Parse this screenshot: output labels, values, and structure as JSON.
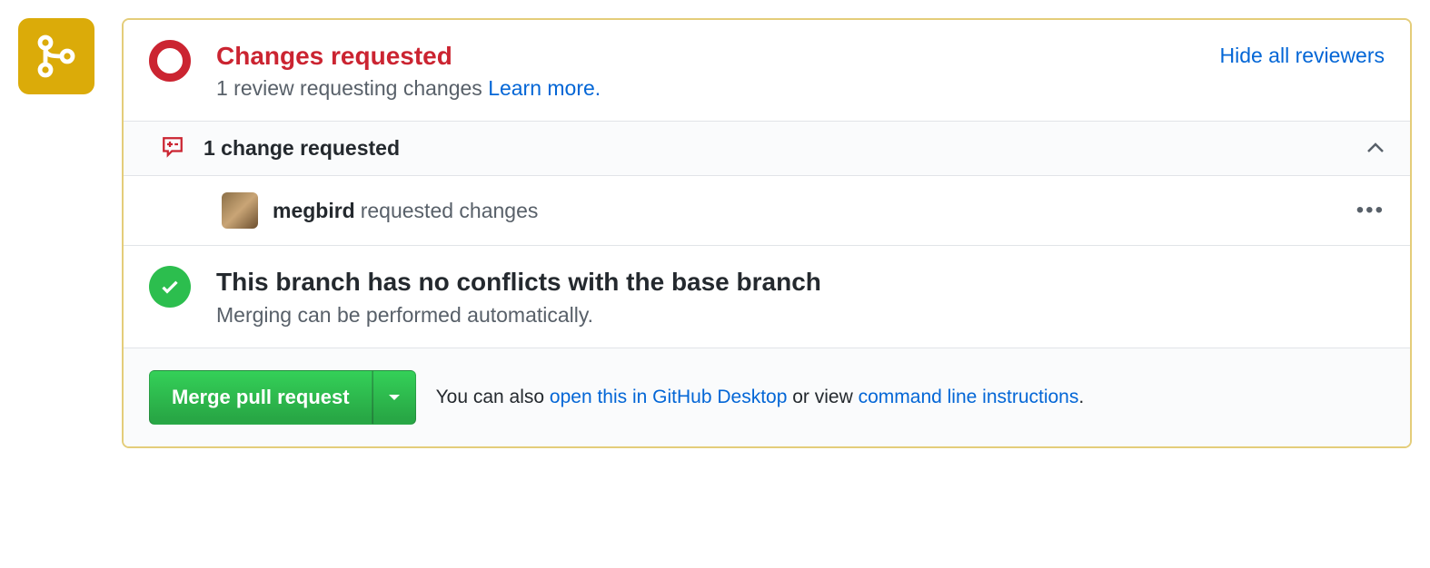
{
  "header": {
    "title": "Changes requested",
    "subtext_prefix": "1 review requesting changes ",
    "learn_more": "Learn more.",
    "hide_link": "Hide all reviewers"
  },
  "changebar": {
    "title": "1 change requested"
  },
  "reviewer": {
    "username": "megbird",
    "action": " requested changes"
  },
  "conflicts": {
    "title": "This branch has no conflicts with the base branch",
    "subtext": "Merging can be performed automatically."
  },
  "merge": {
    "button": "Merge pull request",
    "also_prefix": "You can also ",
    "desktop_link": "open this in GitHub Desktop",
    "or_view": " or view ",
    "cli_link": "command line instructions",
    "period": "."
  }
}
